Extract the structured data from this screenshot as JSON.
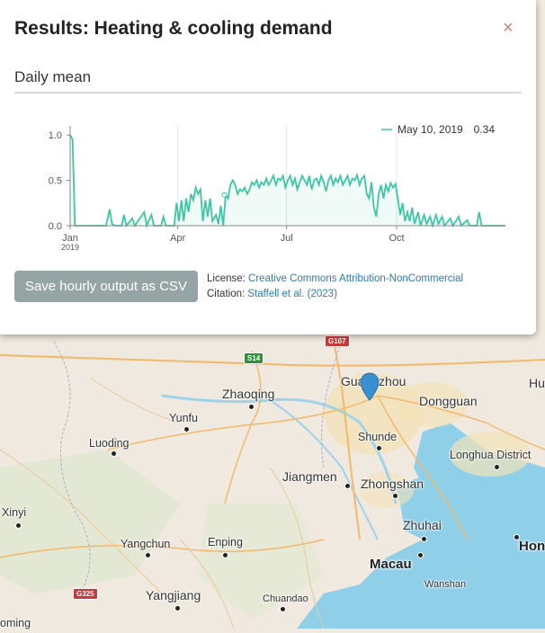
{
  "panel": {
    "title": "Results: Heating & cooling demand",
    "close_glyph": "×",
    "subtitle": "Daily mean",
    "save_button": "Save hourly output as CSV",
    "license_label": "License:",
    "license_link": "Creative Commons Attribution-NonCommercial",
    "citation_label": "Citation:",
    "citation_link": "Staffell et al. (2023)"
  },
  "chart_data": {
    "type": "area",
    "year_label": "2019",
    "x_ticks": [
      "Jan",
      "Apr",
      "Jul",
      "Oct"
    ],
    "y_ticks": [
      "0.0",
      "0.5",
      "1.0"
    ],
    "ylim": [
      0,
      1.1
    ],
    "line_color": "#3cc7a4",
    "legend": {
      "date": "May 10, 2019",
      "value": "0.34"
    },
    "series": [
      {
        "day": 0,
        "value": 1.0
      },
      {
        "day": 2,
        "value": 0.95
      },
      {
        "day": 4,
        "value": 0.0
      },
      {
        "day": 30,
        "value": 0.0
      },
      {
        "day": 33,
        "value": 0.18
      },
      {
        "day": 35,
        "value": 0.02
      },
      {
        "day": 38,
        "value": 0.0
      },
      {
        "day": 43,
        "value": 0.0
      },
      {
        "day": 45,
        "value": 0.12
      },
      {
        "day": 47,
        "value": 0.0
      },
      {
        "day": 52,
        "value": 0.08
      },
      {
        "day": 54,
        "value": 0.0
      },
      {
        "day": 62,
        "value": 0.15
      },
      {
        "day": 64,
        "value": 0.0
      },
      {
        "day": 68,
        "value": 0.12
      },
      {
        "day": 70,
        "value": 0.0
      },
      {
        "day": 76,
        "value": 0.0
      },
      {
        "day": 78,
        "value": 0.1
      },
      {
        "day": 80,
        "value": 0.0
      },
      {
        "day": 87,
        "value": 0.0
      },
      {
        "day": 89,
        "value": 0.25
      },
      {
        "day": 91,
        "value": 0.05
      },
      {
        "day": 93,
        "value": 0.28
      },
      {
        "day": 95,
        "value": 0.05
      },
      {
        "day": 97,
        "value": 0.3
      },
      {
        "day": 99,
        "value": 0.15
      },
      {
        "day": 101,
        "value": 0.35
      },
      {
        "day": 103,
        "value": 0.28
      },
      {
        "day": 105,
        "value": 0.42
      },
      {
        "day": 107,
        "value": 0.35
      },
      {
        "day": 109,
        "value": 0.4
      },
      {
        "day": 111,
        "value": 0.05
      },
      {
        "day": 113,
        "value": 0.28
      },
      {
        "day": 115,
        "value": 0.1
      },
      {
        "day": 117,
        "value": 0.3
      },
      {
        "day": 119,
        "value": 0.05
      },
      {
        "day": 122,
        "value": 0.12
      },
      {
        "day": 124,
        "value": 0.02
      },
      {
        "day": 126,
        "value": 0.22
      },
      {
        "day": 128,
        "value": 0.0
      },
      {
        "day": 130,
        "value": 0.34
      },
      {
        "day": 132,
        "value": 0.3
      },
      {
        "day": 134,
        "value": 0.45
      },
      {
        "day": 136,
        "value": 0.5
      },
      {
        "day": 138,
        "value": 0.45
      },
      {
        "day": 140,
        "value": 0.35
      },
      {
        "day": 142,
        "value": 0.4
      },
      {
        "day": 144,
        "value": 0.38
      },
      {
        "day": 146,
        "value": 0.42
      },
      {
        "day": 148,
        "value": 0.35
      },
      {
        "day": 150,
        "value": 0.4
      },
      {
        "day": 152,
        "value": 0.48
      },
      {
        "day": 154,
        "value": 0.45
      },
      {
        "day": 156,
        "value": 0.5
      },
      {
        "day": 158,
        "value": 0.42
      },
      {
        "day": 160,
        "value": 0.48
      },
      {
        "day": 162,
        "value": 0.45
      },
      {
        "day": 164,
        "value": 0.52
      },
      {
        "day": 166,
        "value": 0.45
      },
      {
        "day": 168,
        "value": 0.5
      },
      {
        "day": 170,
        "value": 0.55
      },
      {
        "day": 172,
        "value": 0.45
      },
      {
        "day": 174,
        "value": 0.52
      },
      {
        "day": 176,
        "value": 0.5
      },
      {
        "day": 178,
        "value": 0.55
      },
      {
        "day": 180,
        "value": 0.42
      },
      {
        "day": 182,
        "value": 0.5
      },
      {
        "day": 184,
        "value": 0.55
      },
      {
        "day": 186,
        "value": 0.45
      },
      {
        "day": 188,
        "value": 0.52
      },
      {
        "day": 190,
        "value": 0.4
      },
      {
        "day": 192,
        "value": 0.48
      },
      {
        "day": 194,
        "value": 0.55
      },
      {
        "day": 196,
        "value": 0.5
      },
      {
        "day": 198,
        "value": 0.45
      },
      {
        "day": 200,
        "value": 0.55
      },
      {
        "day": 202,
        "value": 0.4
      },
      {
        "day": 204,
        "value": 0.5
      },
      {
        "day": 206,
        "value": 0.52
      },
      {
        "day": 208,
        "value": 0.45
      },
      {
        "day": 210,
        "value": 0.55
      },
      {
        "day": 212,
        "value": 0.48
      },
      {
        "day": 214,
        "value": 0.38
      },
      {
        "day": 216,
        "value": 0.5
      },
      {
        "day": 218,
        "value": 0.55
      },
      {
        "day": 220,
        "value": 0.45
      },
      {
        "day": 222,
        "value": 0.52
      },
      {
        "day": 224,
        "value": 0.48
      },
      {
        "day": 226,
        "value": 0.55
      },
      {
        "day": 228,
        "value": 0.45
      },
      {
        "day": 230,
        "value": 0.5
      },
      {
        "day": 232,
        "value": 0.55
      },
      {
        "day": 234,
        "value": 0.45
      },
      {
        "day": 236,
        "value": 0.52
      },
      {
        "day": 238,
        "value": 0.5
      },
      {
        "day": 240,
        "value": 0.56
      },
      {
        "day": 242,
        "value": 0.45
      },
      {
        "day": 244,
        "value": 0.52
      },
      {
        "day": 246,
        "value": 0.55
      },
      {
        "day": 248,
        "value": 0.35
      },
      {
        "day": 250,
        "value": 0.3
      },
      {
        "day": 252,
        "value": 0.48
      },
      {
        "day": 254,
        "value": 0.2
      },
      {
        "day": 256,
        "value": 0.1
      },
      {
        "day": 258,
        "value": 0.35
      },
      {
        "day": 260,
        "value": 0.45
      },
      {
        "day": 262,
        "value": 0.3
      },
      {
        "day": 264,
        "value": 0.45
      },
      {
        "day": 266,
        "value": 0.38
      },
      {
        "day": 268,
        "value": 0.47
      },
      {
        "day": 270,
        "value": 0.42
      },
      {
        "day": 272,
        "value": 0.46
      },
      {
        "day": 274,
        "value": 0.3
      },
      {
        "day": 276,
        "value": 0.12
      },
      {
        "day": 278,
        "value": 0.25
      },
      {
        "day": 280,
        "value": 0.05
      },
      {
        "day": 282,
        "value": 0.15
      },
      {
        "day": 284,
        "value": 0.05
      },
      {
        "day": 286,
        "value": 0.2
      },
      {
        "day": 288,
        "value": 0.02
      },
      {
        "day": 291,
        "value": 0.15
      },
      {
        "day": 293,
        "value": 0.0
      },
      {
        "day": 296,
        "value": 0.12
      },
      {
        "day": 298,
        "value": 0.02
      },
      {
        "day": 301,
        "value": 0.1
      },
      {
        "day": 303,
        "value": 0.0
      },
      {
        "day": 306,
        "value": 0.12
      },
      {
        "day": 308,
        "value": 0.02
      },
      {
        "day": 311,
        "value": 0.1
      },
      {
        "day": 313,
        "value": 0.0
      },
      {
        "day": 318,
        "value": 0.08
      },
      {
        "day": 320,
        "value": 0.0
      },
      {
        "day": 325,
        "value": 0.1
      },
      {
        "day": 327,
        "value": 0.0
      },
      {
        "day": 332,
        "value": 0.06
      },
      {
        "day": 334,
        "value": 0.0
      },
      {
        "day": 340,
        "value": 0.0
      },
      {
        "day": 342,
        "value": 0.15
      },
      {
        "day": 344,
        "value": 0.0
      },
      {
        "day": 364,
        "value": 0.0
      }
    ]
  },
  "map": {
    "labels": [
      {
        "id": "guangzhou",
        "text": "Guangzhou",
        "cls": "big"
      },
      {
        "id": "dongguan",
        "text": "Dongguan",
        "cls": "big"
      },
      {
        "id": "zhaoqing",
        "text": "Zhaoqing",
        "cls": "big"
      },
      {
        "id": "yunfu",
        "text": "Yunfu",
        "cls": "med"
      },
      {
        "id": "luoding",
        "text": "Luoding",
        "cls": "med"
      },
      {
        "id": "shunde",
        "text": "Shunde",
        "cls": "med"
      },
      {
        "id": "jiangmen",
        "text": "Jiangmen",
        "cls": "big"
      },
      {
        "id": "zhongshan",
        "text": "Zhongshan",
        "cls": "big"
      },
      {
        "id": "longhua",
        "text": "Longhua District",
        "cls": "med"
      },
      {
        "id": "zhuhai",
        "text": "Zhuhai",
        "cls": "big"
      },
      {
        "id": "xinyi",
        "text": "Xinyi",
        "cls": "med"
      },
      {
        "id": "yangchun",
        "text": "Yangchun",
        "cls": "med"
      },
      {
        "id": "enping",
        "text": "Enping",
        "cls": "med"
      },
      {
        "id": "macau",
        "text": "Macau",
        "cls": "bold"
      },
      {
        "id": "wanshan",
        "text": "Wanshan",
        "cls": "small"
      },
      {
        "id": "yangjiang",
        "text": "Yangjiang",
        "cls": "big"
      },
      {
        "id": "chuandao",
        "text": "Chuandao",
        "cls": "small"
      },
      {
        "id": "hong",
        "text": "Hon",
        "cls": "bold"
      },
      {
        "id": "hu",
        "text": "Hu",
        "cls": "big"
      },
      {
        "id": "maoming",
        "text": "oming",
        "cls": "med"
      }
    ],
    "shields": [
      {
        "id": "g107",
        "text": "G107",
        "color": "red"
      },
      {
        "id": "s14",
        "text": "S14",
        "color": "green"
      },
      {
        "id": "g325",
        "text": "G325",
        "color": "red"
      }
    ]
  }
}
